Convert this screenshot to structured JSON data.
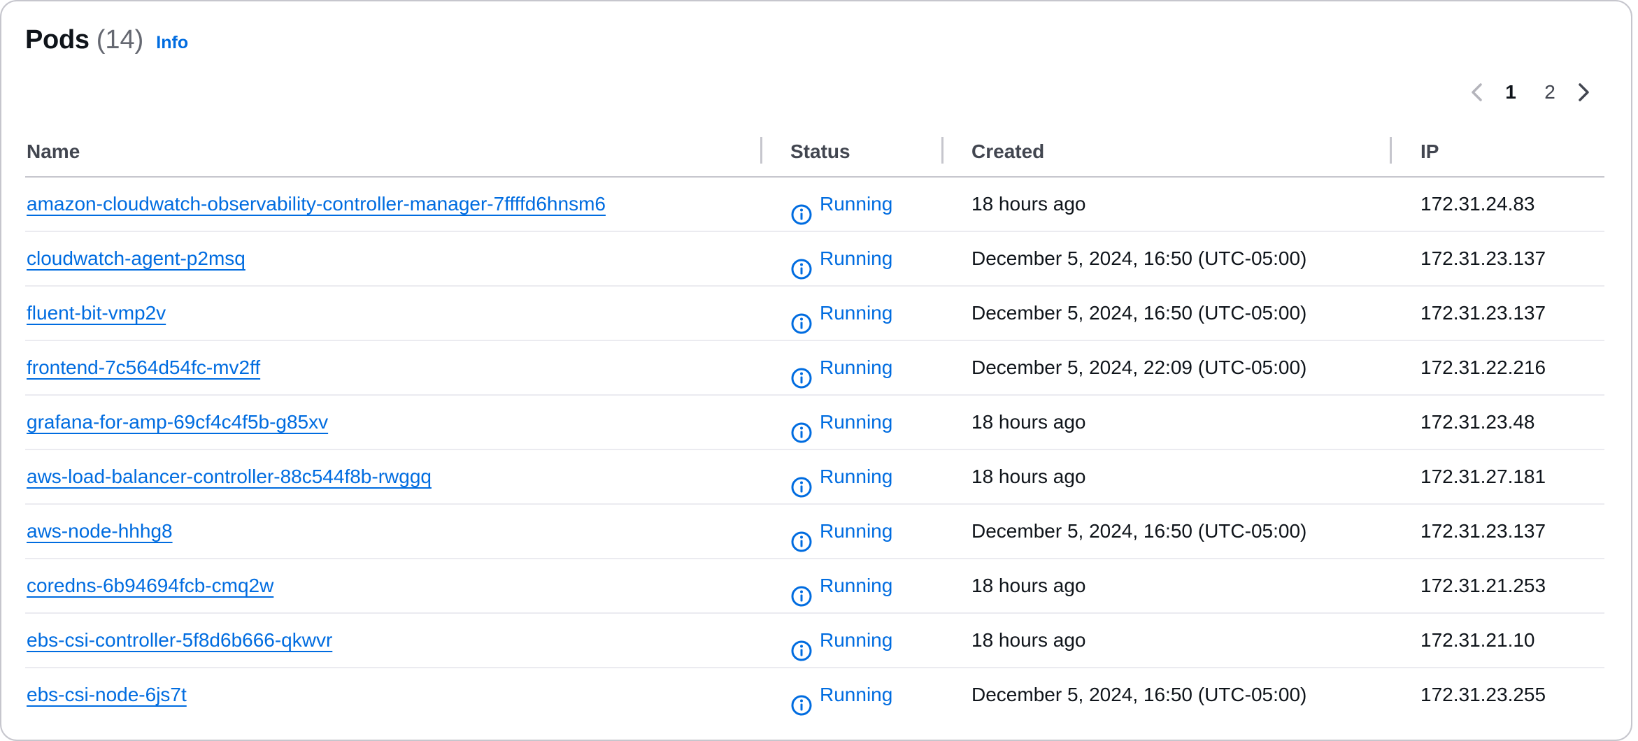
{
  "header": {
    "title": "Pods",
    "count": "(14)",
    "info_label": "Info"
  },
  "pagination": {
    "prev_icon": "chevron-left-icon",
    "next_icon": "chevron-right-icon",
    "pages": [
      "1",
      "2"
    ],
    "current_page": "1"
  },
  "table": {
    "columns": [
      "Name",
      "Status",
      "Created",
      "IP"
    ],
    "rows": [
      {
        "name": "amazon-cloudwatch-observability-controller-manager-7ffffd6hnsm6",
        "status": "Running",
        "created": "18 hours ago",
        "ip": "172.31.24.83"
      },
      {
        "name": "cloudwatch-agent-p2msq",
        "status": "Running",
        "created": "December 5, 2024, 16:50 (UTC-05:00)",
        "ip": "172.31.23.137"
      },
      {
        "name": "fluent-bit-vmp2v",
        "status": "Running",
        "created": "December 5, 2024, 16:50 (UTC-05:00)",
        "ip": "172.31.23.137"
      },
      {
        "name": "frontend-7c564d54fc-mv2ff",
        "status": "Running",
        "created": "December 5, 2024, 22:09 (UTC-05:00)",
        "ip": "172.31.22.216"
      },
      {
        "name": "grafana-for-amp-69cf4c4f5b-g85xv",
        "status": "Running",
        "created": "18 hours ago",
        "ip": "172.31.23.48"
      },
      {
        "name": "aws-load-balancer-controller-88c544f8b-rwggq",
        "status": "Running",
        "created": "18 hours ago",
        "ip": "172.31.27.181"
      },
      {
        "name": "aws-node-hhhg8",
        "status": "Running",
        "created": "December 5, 2024, 16:50 (UTC-05:00)",
        "ip": "172.31.23.137"
      },
      {
        "name": "coredns-6b94694fcb-cmq2w",
        "status": "Running",
        "created": "18 hours ago",
        "ip": "172.31.21.253"
      },
      {
        "name": "ebs-csi-controller-5f8d6b666-qkwvr",
        "status": "Running",
        "created": "18 hours ago",
        "ip": "172.31.21.10"
      },
      {
        "name": "ebs-csi-node-6js7t",
        "status": "Running",
        "created": "December 5, 2024, 16:50 (UTC-05:00)",
        "ip": "172.31.23.255"
      }
    ]
  },
  "colors": {
    "link": "#006ce0",
    "status_info": "#006ce0",
    "text": "#0f141a",
    "muted": "#656871",
    "border": "#c6c6cd"
  },
  "status_icon": "info-circle-icon"
}
